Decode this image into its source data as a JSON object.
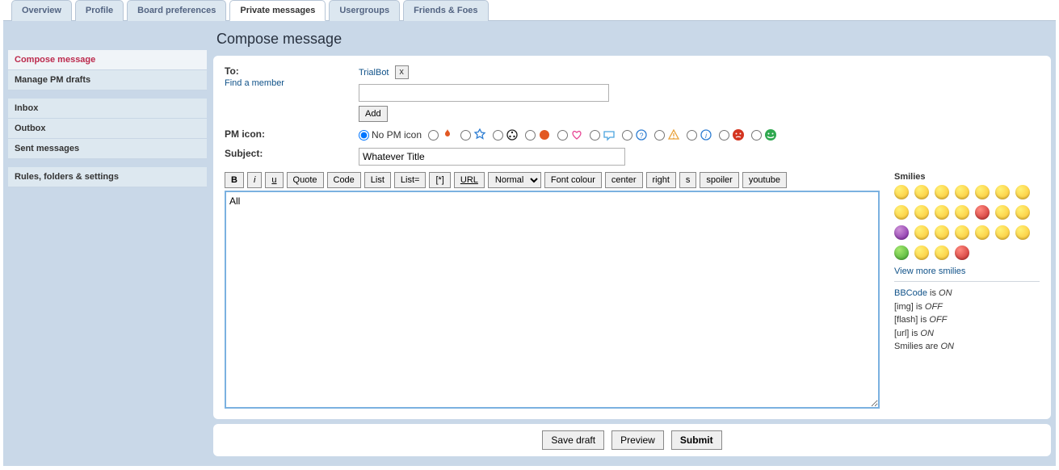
{
  "tabs": {
    "t0": "Overview",
    "t1": "Profile",
    "t2": "Board preferences",
    "t3": "Private messages",
    "t4": "Usergroups",
    "t5": "Friends & Foes"
  },
  "sidebar": {
    "s0": "Compose message",
    "s1": "Manage PM drafts",
    "s2": "Inbox",
    "s3": "Outbox",
    "s4": "Sent messages",
    "s5": "Rules, folders & settings"
  },
  "page_title": "Compose message",
  "labels": {
    "to": "To:",
    "find_member": "Find a member",
    "add": "Add",
    "pm_icon": "PM icon:",
    "no_pm_icon": "No PM icon",
    "subject": "Subject:",
    "smilies_h": "Smilies",
    "view_more": "View more smilies",
    "save_draft": "Save draft",
    "preview": "Preview",
    "submit": "Submit"
  },
  "recipient": {
    "name": "TrialBot",
    "remove": "x"
  },
  "to_input": "",
  "subject_value": "Whatever Title",
  "body_value": "All",
  "toolbar": {
    "b": "B",
    "i": "i",
    "u": "u",
    "quote": "Quote",
    "code": "Code",
    "list": "List",
    "liste": "List=",
    "star": "[*]",
    "url": "URL",
    "normal": "Normal",
    "font_colour": "Font colour",
    "center": "center",
    "right": "right",
    "s": "s",
    "spoiler": "spoiler",
    "youtube": "youtube"
  },
  "status": {
    "bbcode_l": "BBCode",
    "bbcode_m": " is ",
    "bbcode_v": "ON",
    "img": "[img] is ",
    "img_v": "OFF",
    "flash": "[flash] is ",
    "flash_v": "OFF",
    "url": "[url] is ",
    "url_v": "ON",
    "smilies": "Smilies are ",
    "smilies_v": "ON"
  },
  "pm_icon_colors": [
    "#e25822",
    "#2d7dd2",
    "#222",
    "#e25822",
    "#e74694",
    "#4aa3df",
    "#2d7dd2",
    "#e9a23b",
    "#2d7dd2",
    "#d4341f",
    "#2fa84f"
  ]
}
